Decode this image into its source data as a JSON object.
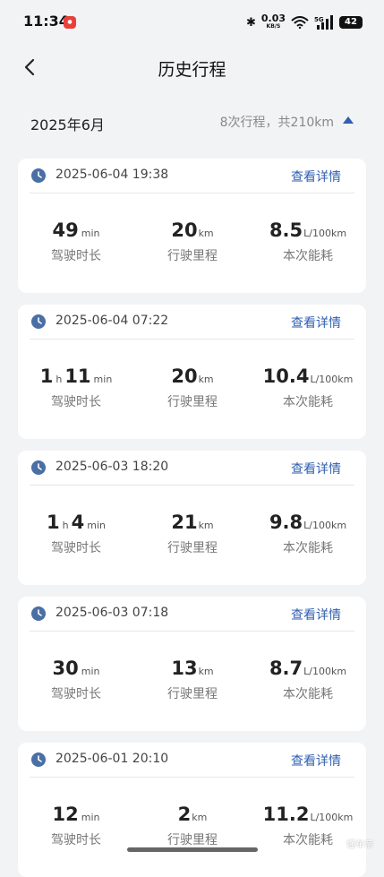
{
  "status_bar": {
    "time": "11:34",
    "app_icon_text": "小红书",
    "net_speed_value": "0.03",
    "net_speed_unit": "KB/S",
    "battery": "42",
    "signal_label": "5G"
  },
  "header": {
    "title": "历史行程"
  },
  "month": {
    "label": "2025年6月",
    "summary": "8次行程，共210km"
  },
  "labels": {
    "detail": "查看详情",
    "duration": "驾驶时长",
    "distance": "行驶里程",
    "consumption": "本次能耗",
    "min_unit": "min",
    "h_unit": "h",
    "km_unit": "km",
    "fuel_unit": "L/100km"
  },
  "trips": [
    {
      "datetime": "2025-06-04 19:38",
      "hours": "",
      "minutes": "49",
      "distance": "20",
      "consumption": "8.5"
    },
    {
      "datetime": "2025-06-04 07:22",
      "hours": "1",
      "minutes": "11",
      "distance": "20",
      "consumption": "10.4"
    },
    {
      "datetime": "2025-06-03 18:20",
      "hours": "1",
      "minutes": "4",
      "distance": "21",
      "consumption": "9.8"
    },
    {
      "datetime": "2025-06-03 07:18",
      "hours": "",
      "minutes": "30",
      "distance": "13",
      "consumption": "8.7"
    },
    {
      "datetime": "2025-06-01 20:10",
      "hours": "",
      "minutes": "12",
      "distance": "2",
      "consumption": "11.2"
    }
  ],
  "watermark": "懂车帝",
  "colors": {
    "accent": "#2f5fb0",
    "background": "#f2f3f5",
    "card": "#ffffff",
    "clock_icon": "#4a6fa5"
  }
}
